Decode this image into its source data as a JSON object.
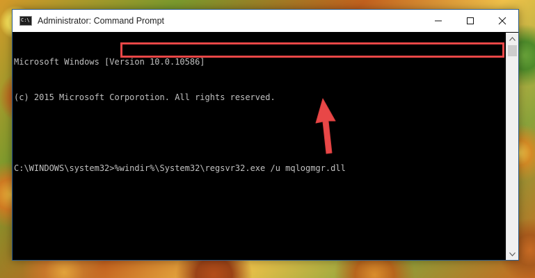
{
  "window": {
    "title": "Administrator: Command Prompt"
  },
  "console": {
    "lines": [
      "Microsoft Windows [Version 10.0.10586]",
      "(c) 2015 Microsoft Corporotion. All rights reserved."
    ],
    "prompt": "C:\\WINDOWS\\system32>",
    "command": "%windir%\\System32\\regsvr32.exe /u mqlogmgr.dll"
  },
  "colors": {
    "highlight": "#e84747",
    "arrow": "#e84747",
    "console_text": "#c0c0c0",
    "console_bg": "#000000"
  },
  "icons": {
    "window_icon": "cmd-icon",
    "minimize": "minimize-icon",
    "maximize": "maximize-icon",
    "close": "close-icon",
    "pointer": "red-arrow-icon"
  }
}
